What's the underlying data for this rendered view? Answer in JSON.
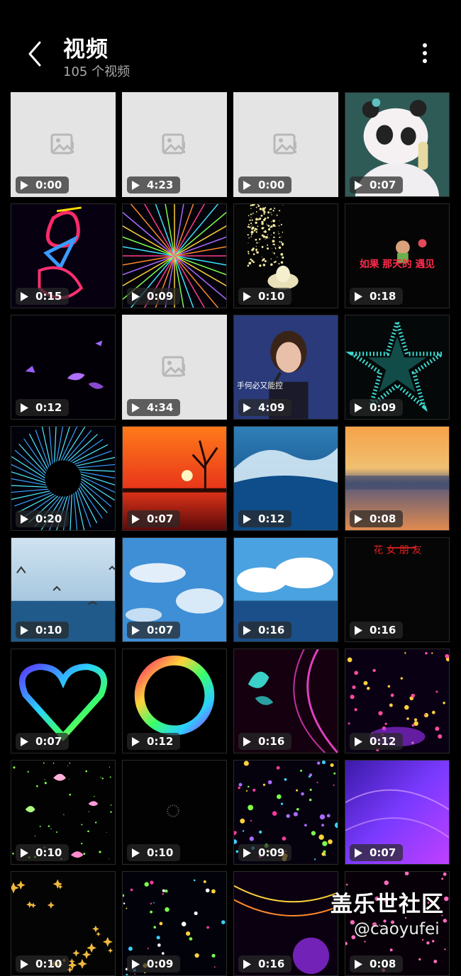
{
  "header": {
    "title": "视频",
    "subtitle": "105 个视频"
  },
  "videos": [
    {
      "duration": "0:00",
      "thumb": "placeholder"
    },
    {
      "duration": "4:23",
      "thumb": "placeholder"
    },
    {
      "duration": "0:00",
      "thumb": "placeholder"
    },
    {
      "duration": "0:07",
      "thumb": "panda"
    },
    {
      "duration": "0:15",
      "thumb": "neon-figure"
    },
    {
      "duration": "0:09",
      "thumb": "light-burst"
    },
    {
      "duration": "0:10",
      "thumb": "lotus-sparkle"
    },
    {
      "duration": "0:18",
      "thumb": "text-card",
      "text": "如果 那天的 遇见"
    },
    {
      "duration": "0:12",
      "thumb": "purple-butterflies"
    },
    {
      "duration": "4:34",
      "thumb": "placeholder"
    },
    {
      "duration": "4:09",
      "thumb": "singer",
      "text": "手何必又能控"
    },
    {
      "duration": "0:09",
      "thumb": "cyan-star"
    },
    {
      "duration": "0:20",
      "thumb": "light-tunnel"
    },
    {
      "duration": "0:07",
      "thumb": "sunset-tree"
    },
    {
      "duration": "0:12",
      "thumb": "wave"
    },
    {
      "duration": "0:08",
      "thumb": "beach-sunset"
    },
    {
      "duration": "0:10",
      "thumb": "seagulls"
    },
    {
      "duration": "0:07",
      "thumb": "blue-sky"
    },
    {
      "duration": "0:16",
      "thumb": "sea-clouds"
    },
    {
      "duration": "0:16",
      "thumb": "dark-text",
      "text": "花 女 朋 友"
    },
    {
      "duration": "0:07",
      "thumb": "rainbow-heart"
    },
    {
      "duration": "0:12",
      "thumb": "rainbow-ring"
    },
    {
      "duration": "0:16",
      "thumb": "pink-butterfly"
    },
    {
      "duration": "0:12",
      "thumb": "music-petals"
    },
    {
      "duration": "0:10",
      "thumb": "flying-butterflies"
    },
    {
      "duration": "0:10",
      "thumb": "dark-sparkle"
    },
    {
      "duration": "0:09",
      "thumb": "bokeh-stars"
    },
    {
      "duration": "0:07",
      "thumb": "purple-waves"
    },
    {
      "duration": "0:10",
      "thumb": "gold-stars"
    },
    {
      "duration": "0:09",
      "thumb": "colored-stars"
    },
    {
      "duration": "0:16",
      "thumb": "music-flower"
    },
    {
      "duration": "0:08",
      "thumb": "pink-hearts"
    }
  ],
  "watermark": {
    "line1": "盖乐世社区",
    "line2": "@caoyufei"
  },
  "icons": {
    "back": "chevron-left-icon",
    "more": "more-vertical-icon",
    "play": "play-icon",
    "placeholder": "broken-image-icon"
  }
}
